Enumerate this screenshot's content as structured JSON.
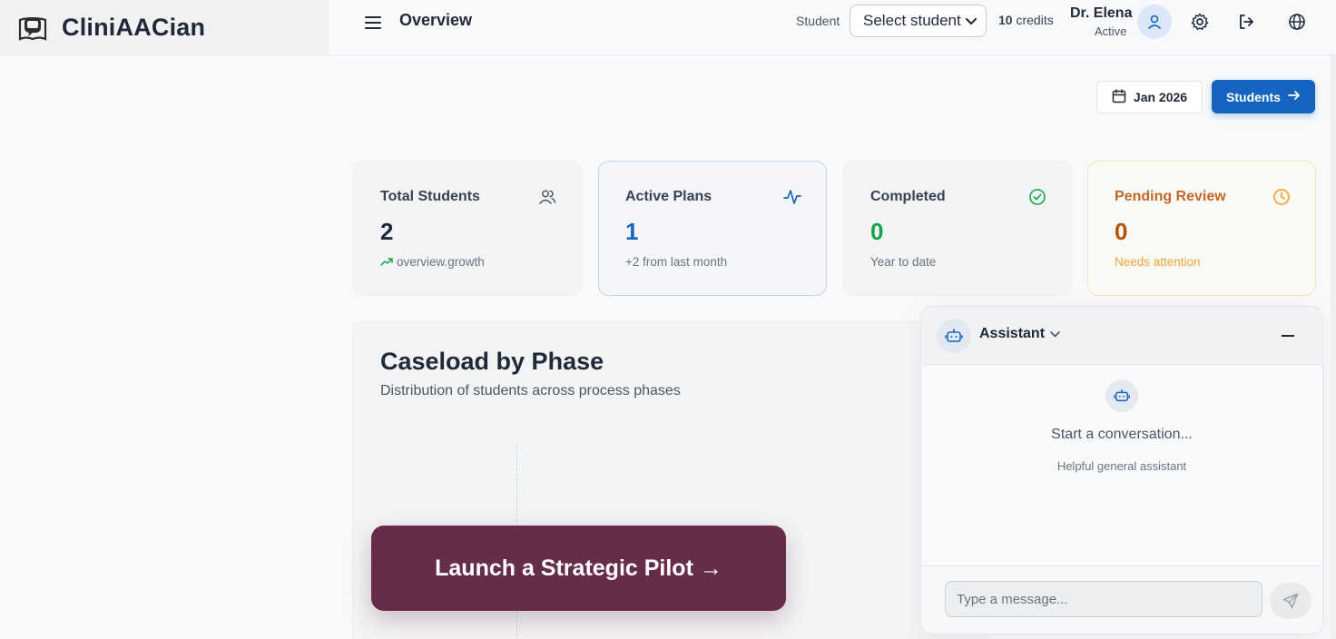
{
  "brand": {
    "name": "CliniAACian",
    "logo_icon": "book-speech-icon"
  },
  "header": {
    "title": "Overview",
    "student_label": "Student",
    "student_select": {
      "selected": "Select student",
      "options": [
        "Select student"
      ]
    },
    "credits_count": "10",
    "credits_label": "credits",
    "user": {
      "name": "Dr. Elena",
      "status": "Active"
    }
  },
  "toolbar": {
    "date_label": "Jan 2026",
    "students_label": "Students"
  },
  "stats": [
    {
      "title": "Total Students",
      "value": "2",
      "sub": "overview.growth",
      "icon": "users-icon"
    },
    {
      "title": "Active Plans",
      "value": "1",
      "sub": "+2 from last month",
      "icon": "activity-icon"
    },
    {
      "title": "Completed",
      "value": "0",
      "sub": "Year to date",
      "icon": "check-circle-icon"
    },
    {
      "title": "Pending Review",
      "value": "0",
      "sub": "Needs attention",
      "icon": "clock-icon"
    }
  ],
  "caseload": {
    "title": "Caseload by Phase",
    "subtitle": "Distribution of students across process phases"
  },
  "cta": {
    "label": "Launch a Strategic Pilot →"
  },
  "assistant": {
    "name": "Assistant",
    "empty_title": "Start a conversation...",
    "empty_sub": "Helpful general assistant",
    "input_placeholder": "Type a message..."
  },
  "colors": {
    "primary": "#1565c0",
    "cta": "#662d4a",
    "value_active": "#1565c0",
    "value_completed": "#16a34a",
    "value_pending": "#b45309",
    "pending_text": "#f0a43c"
  }
}
